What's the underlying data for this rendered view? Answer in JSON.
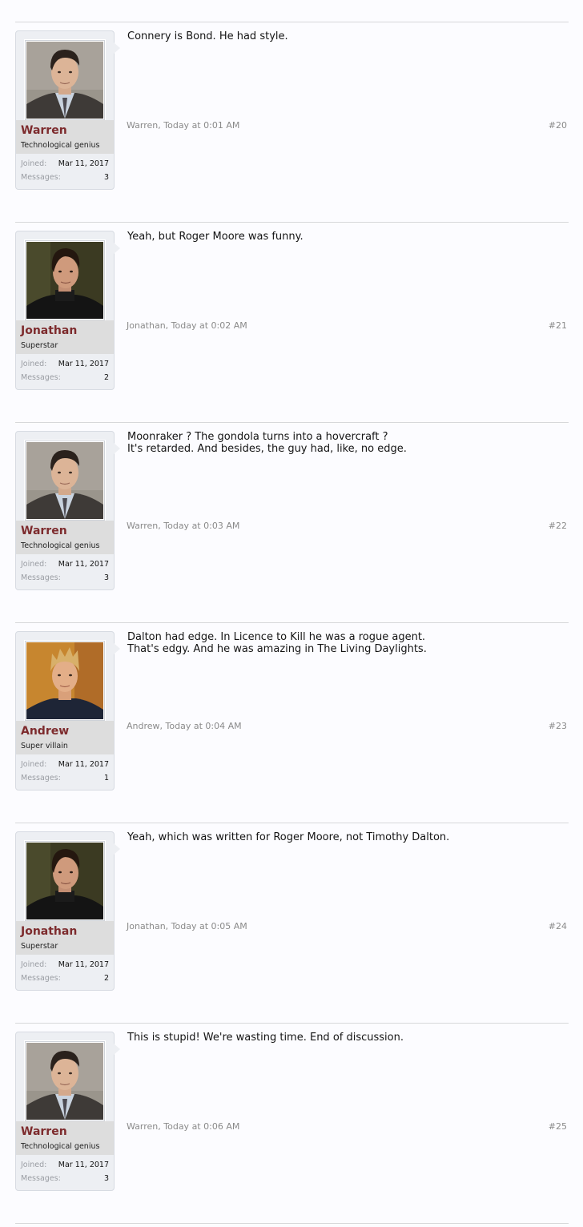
{
  "posts": [
    {
      "username": "Warren",
      "user_title": "Technological genius",
      "joined_label": "Joined:",
      "joined_value": "Mar 11, 2017",
      "messages_label": "Messages:",
      "messages_value": "3",
      "message_lines": [
        "Connery is Bond. He had style."
      ],
      "attribution": "Warren, Today at 0:01 AM",
      "post_number": "#20"
    },
    {
      "username": "Jonathan",
      "user_title": "Superstar",
      "joined_label": "Joined:",
      "joined_value": "Mar 11, 2017",
      "messages_label": "Messages:",
      "messages_value": "2",
      "message_lines": [
        "Yeah, but Roger Moore was funny."
      ],
      "attribution": "Jonathan, Today at 0:02 AM",
      "post_number": "#21"
    },
    {
      "username": "Warren",
      "user_title": "Technological genius",
      "joined_label": "Joined:",
      "joined_value": "Mar 11, 2017",
      "messages_label": "Messages:",
      "messages_value": "3",
      "message_lines": [
        "Moonraker ? The gondola turns into a hovercraft ?",
        "It's retarded. And besides, the guy had, like, no edge."
      ],
      "attribution": "Warren, Today at 0:03 AM",
      "post_number": "#22"
    },
    {
      "username": "Andrew",
      "user_title": "Super villain",
      "joined_label": "Joined:",
      "joined_value": "Mar 11, 2017",
      "messages_label": "Messages:",
      "messages_value": "1",
      "message_lines": [
        "Dalton had edge. In Licence to Kill he was a rogue agent.",
        "That's edgy. And he was amazing in The Living Daylights."
      ],
      "attribution": "Andrew, Today at 0:04 AM",
      "post_number": "#23"
    },
    {
      "username": "Jonathan",
      "user_title": "Superstar",
      "joined_label": "Joined:",
      "joined_value": "Mar 11, 2017",
      "messages_label": "Messages:",
      "messages_value": "2",
      "message_lines": [
        "Yeah, which was written for Roger Moore, not Timothy Dalton."
      ],
      "attribution": "Jonathan, Today at 0:05 AM",
      "post_number": "#24"
    },
    {
      "username": "Warren",
      "user_title": "Technological genius",
      "joined_label": "Joined:",
      "joined_value": "Mar 11, 2017",
      "messages_label": "Messages:",
      "messages_value": "3",
      "message_lines": [
        "This is stupid! We're wasting time. End of discussion."
      ],
      "attribution": "Warren, Today at 0:06 AM",
      "post_number": "#25"
    }
  ],
  "colors": {
    "username": "#7d2b2d",
    "page_background": "#fcfcff",
    "userblock_background": "#edeff3",
    "name_band": "#dddddd",
    "meta_text": "#8a8a8a"
  }
}
